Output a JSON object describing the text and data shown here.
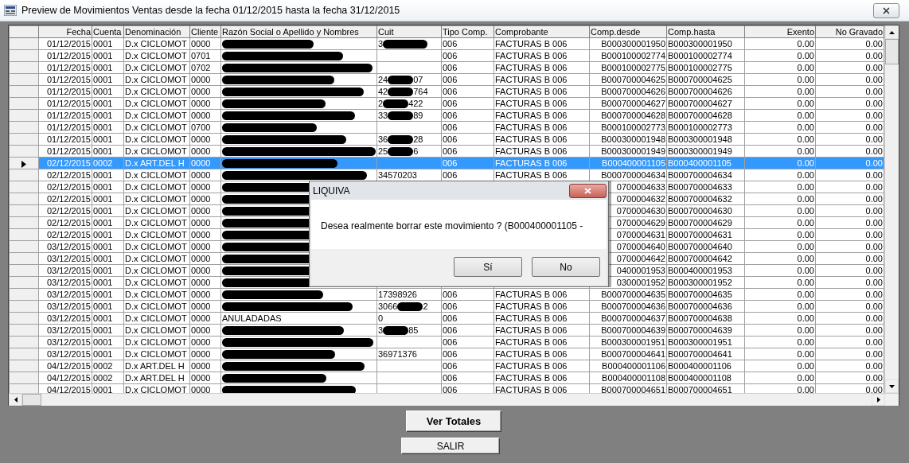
{
  "window": {
    "title": "Preview de Movimientos Ventas  desde la fecha 01/12/2015 hasta la fecha 31/12/2015"
  },
  "table": {
    "columns": [
      "Fecha",
      "Cuenta",
      "Denominación",
      "Cliente",
      "Razón Social o Apellido y Nombres",
      "Cuit",
      "Tipo Comp.",
      "Comprobante",
      "Comp.desde",
      "Comp.hasta",
      "Exento",
      "No Gravado"
    ],
    "rows": [
      {
        "fecha": "01/12/2015",
        "cuenta": "0001",
        "denominacion": "D.x CICLOMOT",
        "cliente": "0000",
        "redacted": true,
        "cuit": "3",
        "cuit_redacted": true,
        "tipo": "006",
        "comprobante": "FACTURAS B 006",
        "desde": "B000300001950",
        "hasta": "B000300001950",
        "exento": "0.00",
        "no_gravado": "0.00",
        "selected": false
      },
      {
        "fecha": "01/12/2015",
        "cuenta": "0001",
        "denominacion": "D.x CICLOMOT",
        "cliente": "0701",
        "redacted": true,
        "tipo": "006",
        "comprobante": "FACTURAS B 006",
        "desde": "B000100002774",
        "hasta": "B000100002774",
        "exento": "0.00",
        "no_gravado": "0.00",
        "selected": false
      },
      {
        "fecha": "01/12/2015",
        "cuenta": "0001",
        "denominacion": "D.x CICLOMOT",
        "cliente": "0702",
        "redacted": true,
        "tipo": "006",
        "comprobante": "FACTURAS B 006",
        "desde": "B000100002775",
        "hasta": "B000100002775",
        "exento": "0.00",
        "no_gravado": "0.00",
        "selected": false
      },
      {
        "fecha": "01/12/2015",
        "cuenta": "0001",
        "denominacion": "D.x CICLOMOT",
        "cliente": "0000",
        "redacted": true,
        "cuit": "24",
        "cuit_redacted": true,
        "cuit_end": "07",
        "tipo": "006",
        "comprobante": "FACTURAS B 006",
        "desde": "B000700004625",
        "hasta": "B000700004625",
        "exento": "0.00",
        "no_gravado": "0.00",
        "selected": false
      },
      {
        "fecha": "01/12/2015",
        "cuenta": "0001",
        "denominacion": "D.x CICLOMOT",
        "cliente": "0000",
        "redacted": true,
        "cuit": "42",
        "cuit_redacted": true,
        "cuit_end": "764",
        "tipo": "006",
        "comprobante": "FACTURAS B 006",
        "desde": "B000700004626",
        "hasta": "B000700004626",
        "exento": "0.00",
        "no_gravado": "0.00",
        "selected": false
      },
      {
        "fecha": "01/12/2015",
        "cuenta": "0001",
        "denominacion": "D.x CICLOMOT",
        "cliente": "0000",
        "redacted": true,
        "cuit": "2",
        "cuit_redacted": true,
        "cuit_end": "422",
        "tipo": "006",
        "comprobante": "FACTURAS B 006",
        "desde": "B000700004627",
        "hasta": "B000700004627",
        "exento": "0.00",
        "no_gravado": "0.00",
        "selected": false
      },
      {
        "fecha": "01/12/2015",
        "cuenta": "0001",
        "denominacion": "D.x CICLOMOT",
        "cliente": "0000",
        "redacted": true,
        "cuit": "33",
        "cuit_redacted": true,
        "cuit_end": "89",
        "tipo": "006",
        "comprobante": "FACTURAS B 006",
        "desde": "B000700004628",
        "hasta": "B000700004628",
        "exento": "0.00",
        "no_gravado": "0.00",
        "selected": false
      },
      {
        "fecha": "01/12/2015",
        "cuenta": "0001",
        "denominacion": "D.x CICLOMOT",
        "cliente": "0700",
        "redacted": true,
        "tipo": "006",
        "comprobante": "FACTURAS B 006",
        "desde": "B000100002773",
        "hasta": "B000100002773",
        "exento": "0.00",
        "no_gravado": "0.00",
        "selected": false
      },
      {
        "fecha": "01/12/2015",
        "cuenta": "0001",
        "denominacion": "D.x CICLOMOT",
        "cliente": "0000",
        "redacted": true,
        "cuit": "36",
        "cuit_redacted": true,
        "cuit_end": "28",
        "tipo": "006",
        "comprobante": "FACTURAS B 006",
        "desde": "B000300001948",
        "hasta": "B000300001948",
        "exento": "0.00",
        "no_gravado": "0.00",
        "selected": false
      },
      {
        "fecha": "01/12/2015",
        "cuenta": "0001",
        "denominacion": "D.x CICLOMOT",
        "cliente": "0000",
        "redacted": true,
        "cuit": "25",
        "cuit_redacted": true,
        "cuit_end": "6",
        "tipo": "006",
        "comprobante": "FACTURAS B 006",
        "desde": "B000300001949",
        "hasta": "B000300001949",
        "exento": "0.00",
        "no_gravado": "0.00",
        "selected": false
      },
      {
        "fecha": "02/12/2015",
        "cuenta": "0002",
        "denominacion": "D.x ART.DEL H",
        "cliente": "0000",
        "redacted": true,
        "tipo": "006",
        "comprobante": "FACTURAS B 006",
        "desde": "B000400001105",
        "hasta": "B000400001105",
        "exento": "0.00",
        "no_gravado": "0.00",
        "selected": true
      },
      {
        "fecha": "02/12/2015",
        "cuenta": "0001",
        "denominacion": "D.x CICLOMOT",
        "cliente": "0000",
        "redacted": true,
        "cuit": "34570203",
        "tipo": "006",
        "comprobante": "FACTURAS B 006",
        "desde": "B000700004634",
        "hasta": "B000700004634",
        "exento": "0.00",
        "no_gravado": "0.00",
        "selected": false
      },
      {
        "fecha": "02/12/2015",
        "cuenta": "0001",
        "denominacion": "D.x CICLOMOT",
        "cliente": "0000",
        "redacted": true,
        "desde": "0700004633",
        "hasta": "B000700004633",
        "exento": "0.00",
        "no_gravado": "0.00",
        "selected": false
      },
      {
        "fecha": "02/12/2015",
        "cuenta": "0001",
        "denominacion": "D.x CICLOMOT",
        "cliente": "0000",
        "redacted": true,
        "desde": "0700004632",
        "hasta": "B000700004632",
        "exento": "0.00",
        "no_gravado": "0.00",
        "selected": false
      },
      {
        "fecha": "02/12/2015",
        "cuenta": "0001",
        "denominacion": "D.x CICLOMOT",
        "cliente": "0000",
        "redacted": true,
        "desde": "0700004630",
        "hasta": "B000700004630",
        "exento": "0.00",
        "no_gravado": "0.00",
        "selected": false
      },
      {
        "fecha": "02/12/2015",
        "cuenta": "0001",
        "denominacion": "D.x CICLOMOT",
        "cliente": "0000",
        "redacted": true,
        "desde": "0700004629",
        "hasta": "B000700004629",
        "exento": "0.00",
        "no_gravado": "0.00",
        "selected": false
      },
      {
        "fecha": "02/12/2015",
        "cuenta": "0001",
        "denominacion": "D.x CICLOMOT",
        "cliente": "0000",
        "redacted": true,
        "desde": "0700004631",
        "hasta": "B000700004631",
        "exento": "0.00",
        "no_gravado": "0.00",
        "selected": false
      },
      {
        "fecha": "03/12/2015",
        "cuenta": "0001",
        "denominacion": "D.x CICLOMOT",
        "cliente": "0000",
        "redacted": true,
        "desde": "0700004640",
        "hasta": "B000700004640",
        "exento": "0.00",
        "no_gravado": "0.00",
        "selected": false
      },
      {
        "fecha": "03/12/2015",
        "cuenta": "0001",
        "denominacion": "D.x CICLOMOT",
        "cliente": "0000",
        "redacted": true,
        "desde": "0700004642",
        "hasta": "B000700004642",
        "exento": "0.00",
        "no_gravado": "0.00",
        "selected": false
      },
      {
        "fecha": "03/12/2015",
        "cuenta": "0001",
        "denominacion": "D.x CICLOMOT",
        "cliente": "0000",
        "redacted": true,
        "desde": "0400001953",
        "hasta": "B000400001953",
        "exento": "0.00",
        "no_gravado": "0.00",
        "selected": false
      },
      {
        "fecha": "03/12/2015",
        "cuenta": "0001",
        "denominacion": "D.x CICLOMOT",
        "cliente": "0000",
        "redacted": true,
        "desde": "0300001952",
        "hasta": "B000300001952",
        "exento": "0.00",
        "no_gravado": "0.00",
        "selected": false
      },
      {
        "fecha": "03/12/2015",
        "cuenta": "0001",
        "denominacion": "D.x CICLOMOT",
        "cliente": "0000",
        "redacted": true,
        "cuit": "17398926",
        "tipo": "006",
        "comprobante": "FACTURAS B 006",
        "desde": "B000700004635",
        "hasta": "B000700004635",
        "exento": "0.00",
        "no_gravado": "0.00",
        "selected": false
      },
      {
        "fecha": "03/12/2015",
        "cuenta": "0001",
        "denominacion": "D.x CICLOMOT",
        "cliente": "0000",
        "redacted": true,
        "cuit": "3066",
        "cuit_redacted": true,
        "cuit_end": "2",
        "tipo": "006",
        "comprobante": "FACTURAS B 006",
        "desde": "B000700004636",
        "hasta": "B000700004636",
        "exento": "0.00",
        "no_gravado": "0.00",
        "selected": false
      },
      {
        "fecha": "03/12/2015",
        "cuenta": "0001",
        "denominacion": "D.x CICLOMOT",
        "cliente": "0000",
        "razon": "ANULADADAS",
        "cuit": "0",
        "tipo": "006",
        "comprobante": "FACTURAS B 006",
        "desde": "B000700004637",
        "hasta": "B000700004638",
        "exento": "0.00",
        "no_gravado": "0.00",
        "selected": false
      },
      {
        "fecha": "03/12/2015",
        "cuenta": "0001",
        "denominacion": "D.x CICLOMOT",
        "cliente": "0000",
        "redacted": true,
        "cuit": "3",
        "cuit_redacted": true,
        "cuit_end": "85",
        "tipo": "006",
        "comprobante": "FACTURAS B 006",
        "desde": "B000700004639",
        "hasta": "B000700004639",
        "exento": "0.00",
        "no_gravado": "0.00",
        "selected": false
      },
      {
        "fecha": "03/12/2015",
        "cuenta": "0001",
        "denominacion": "D.x CICLOMOT",
        "cliente": "0000",
        "redacted": true,
        "tipo": "006",
        "comprobante": "FACTURAS B 006",
        "desde": "B000300001951",
        "hasta": "B000300001951",
        "exento": "0.00",
        "no_gravado": "0.00",
        "selected": false
      },
      {
        "fecha": "03/12/2015",
        "cuenta": "0001",
        "denominacion": "D.x CICLOMOT",
        "cliente": "0000",
        "redacted": true,
        "cuit": "36971376",
        "tipo": "006",
        "comprobante": "FACTURAS B 006",
        "desde": "B000700004641",
        "hasta": "B000700004641",
        "exento": "0.00",
        "no_gravado": "0.00",
        "selected": false
      },
      {
        "fecha": "04/12/2015",
        "cuenta": "0002",
        "denominacion": "D.x ART.DEL H",
        "cliente": "0000",
        "redacted": true,
        "tipo": "006",
        "comprobante": "FACTURAS B 006",
        "desde": "B000400001106",
        "hasta": "B000400001106",
        "exento": "0.00",
        "no_gravado": "0.00",
        "selected": false
      },
      {
        "fecha": "04/12/2015",
        "cuenta": "0002",
        "denominacion": "D.x ART.DEL H",
        "cliente": "0000",
        "redacted": true,
        "tipo": "006",
        "comprobante": "FACTURAS B 006",
        "desde": "B000400001108",
        "hasta": "B000400001108",
        "exento": "0.00",
        "no_gravado": "0.00",
        "selected": false
      },
      {
        "fecha": "04/12/2015",
        "cuenta": "0001",
        "denominacion": "D.x CICLOMOT",
        "cliente": "0000",
        "redacted": true,
        "tipo": "006",
        "comprobante": "FACTURAS B 006",
        "desde": "B000700004651",
        "hasta": "B000700004651",
        "exento": "0.00",
        "no_gravado": "0.00",
        "selected": false
      }
    ]
  },
  "buttons": [
    "Ver Totales",
    "SALIR"
  ],
  "dialog": {
    "title": "LIQUIVA",
    "message": "Desea realmente borrar este movimiento ? (B000400001105 -",
    "buttons": [
      "Sí",
      "No"
    ]
  }
}
